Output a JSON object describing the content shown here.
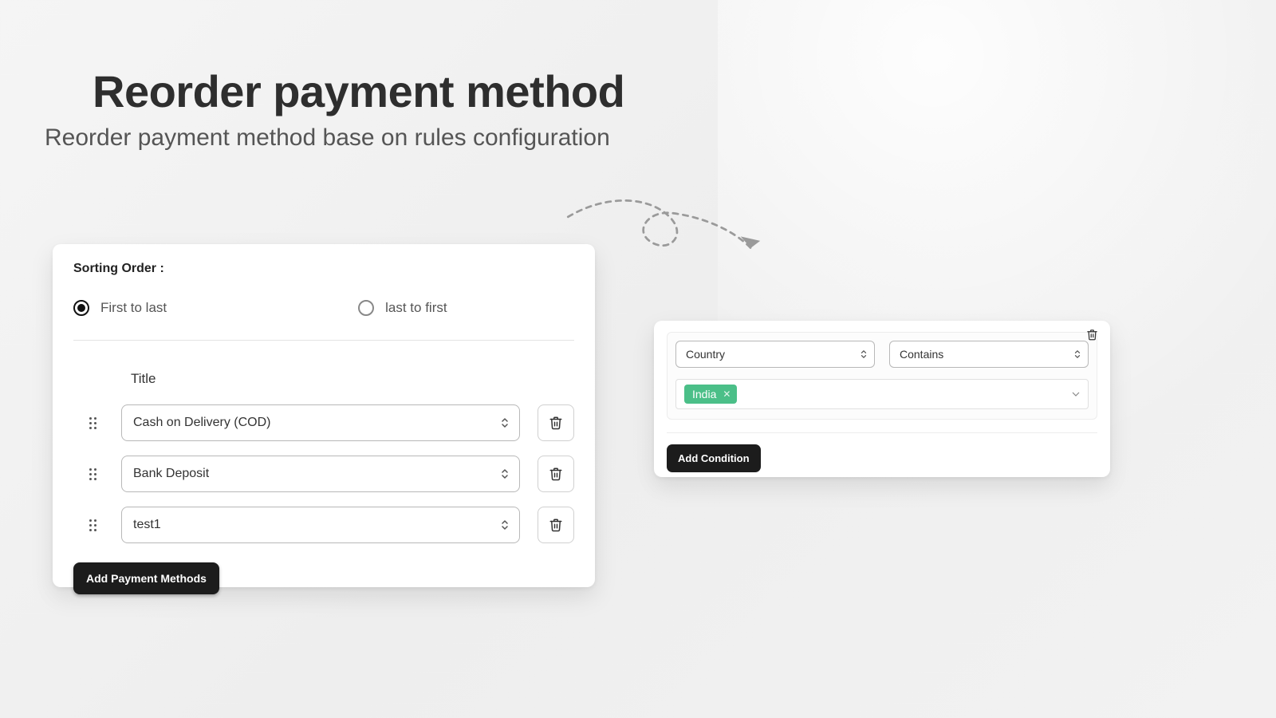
{
  "header": {
    "title": "Reorder payment method",
    "subtitle": "Reorder payment method base on rules configuration"
  },
  "left_card": {
    "sorting_label": "Sorting Order :",
    "radios": [
      {
        "label": "First to last",
        "selected": true
      },
      {
        "label": "last to first",
        "selected": false
      }
    ],
    "title_column": "Title",
    "methods": [
      {
        "value": "Cash on Delivery (COD)"
      },
      {
        "value": "Bank Deposit"
      },
      {
        "value": "test1"
      }
    ],
    "add_button": "Add Payment Methods"
  },
  "right_card": {
    "field_select": "Country",
    "operator_select": "Contains",
    "tags": [
      {
        "label": "India"
      }
    ],
    "add_condition": "Add Condition"
  }
}
